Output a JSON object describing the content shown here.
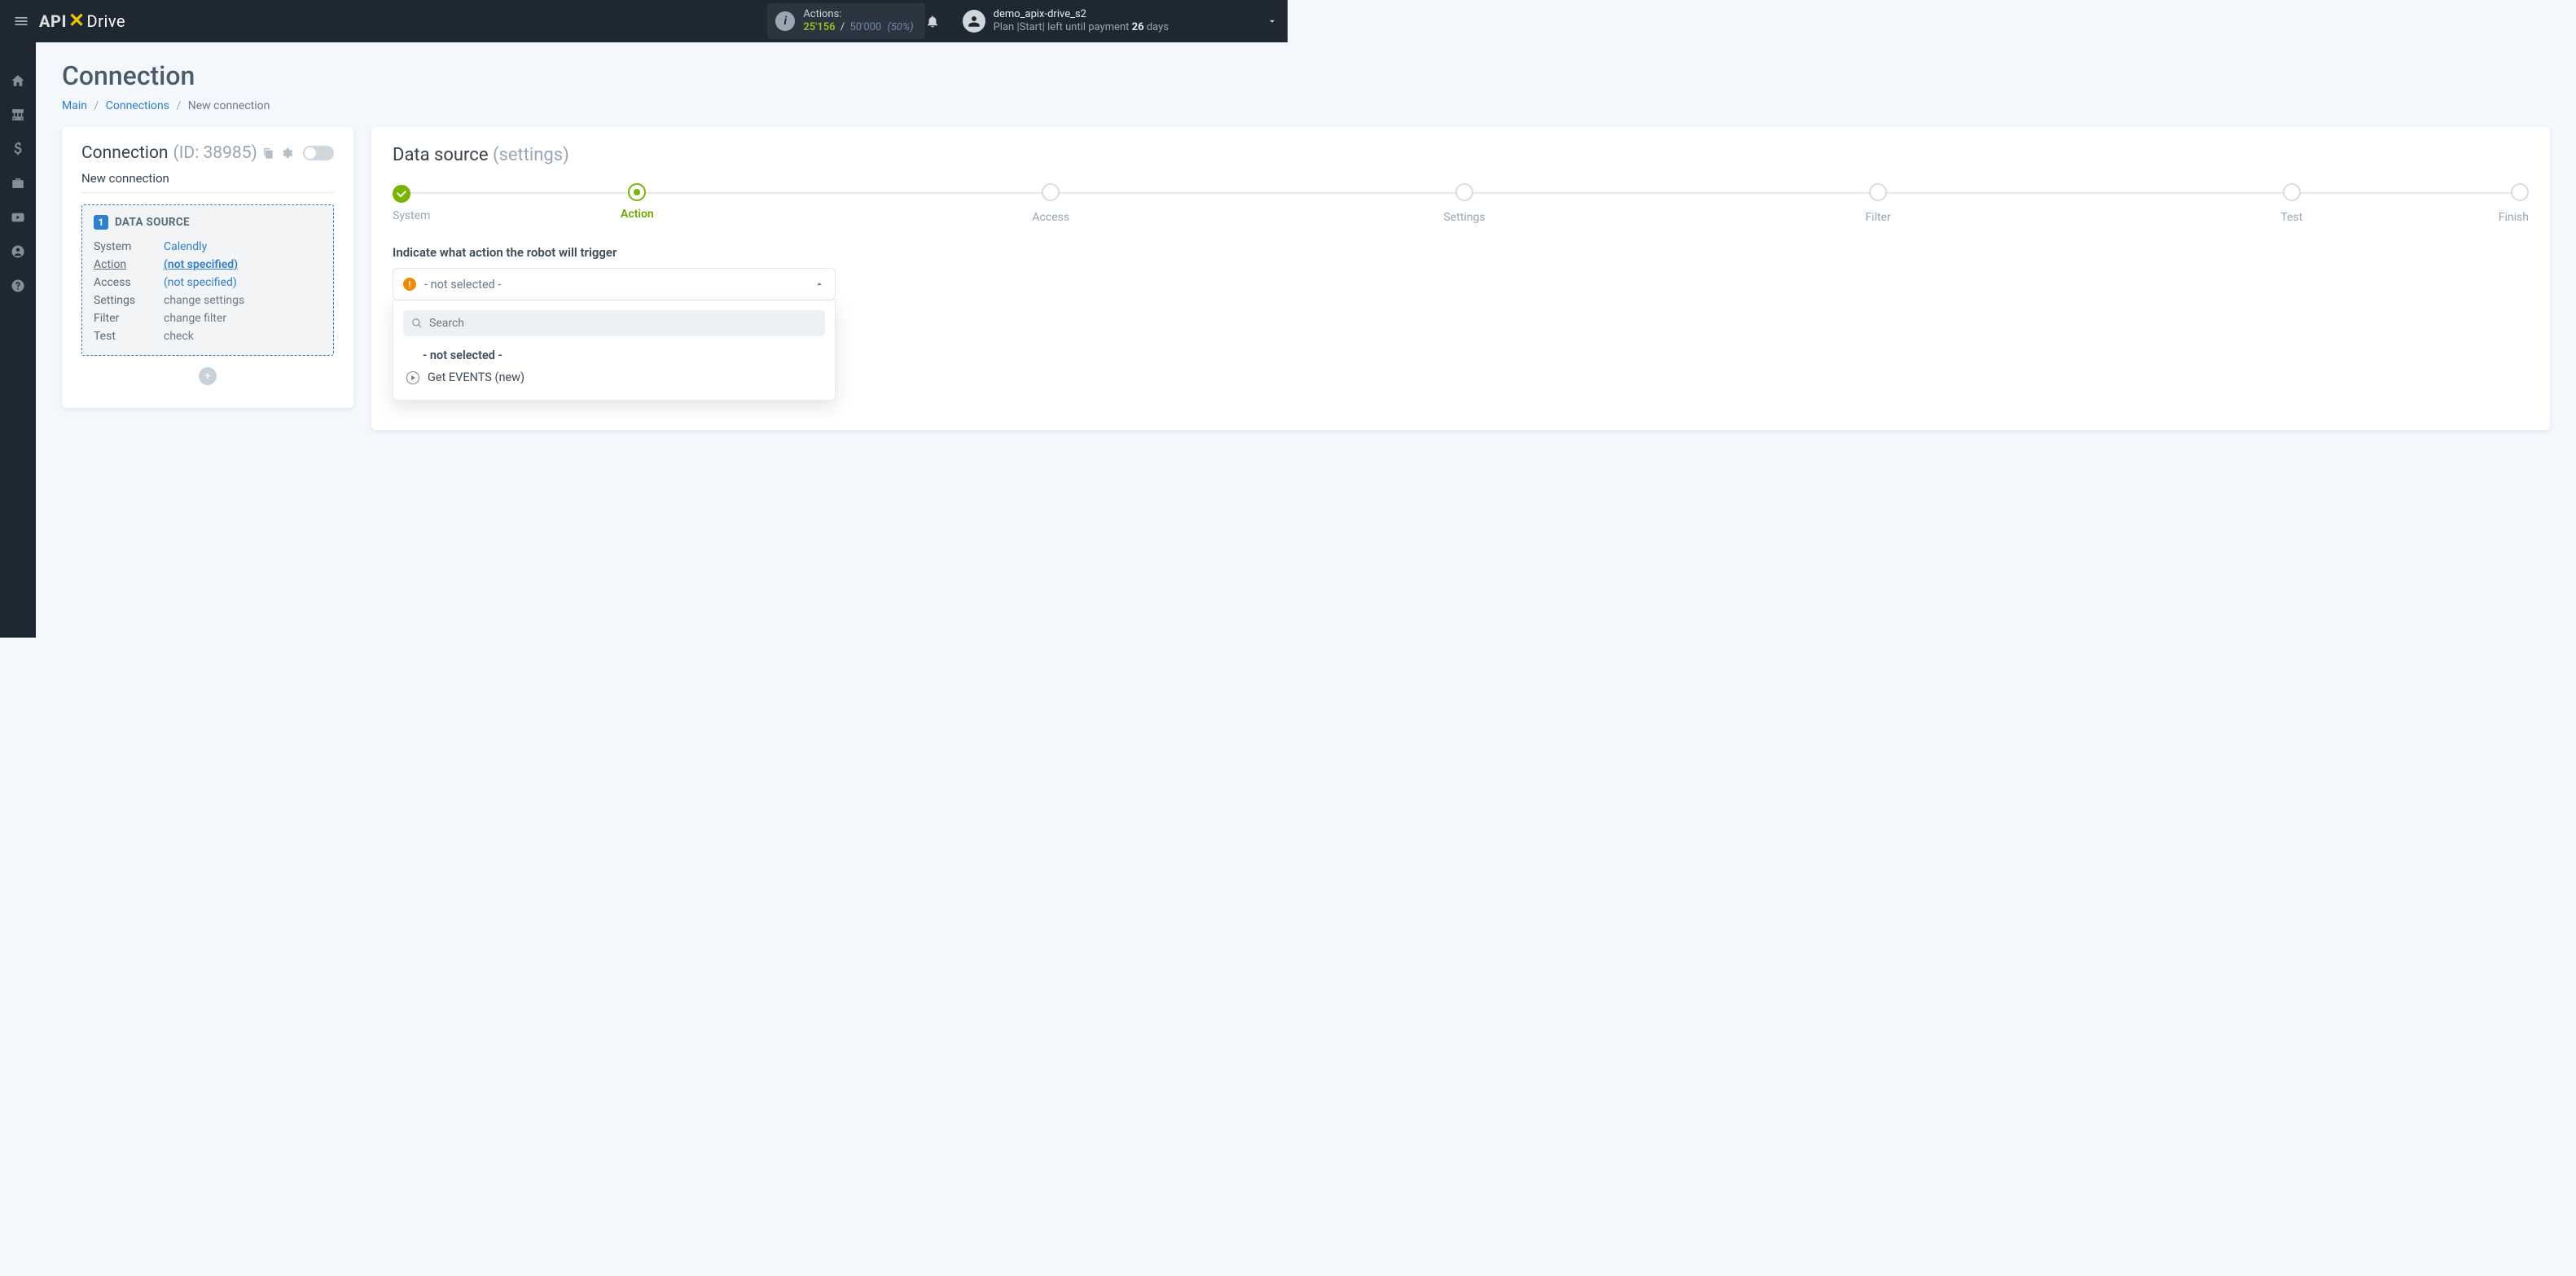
{
  "header": {
    "logo_api": "API",
    "logo_drive": "Drive",
    "actions_label": "Actions:",
    "actions_used": "25'156",
    "actions_limit": "50'000",
    "actions_pct": "(50%)",
    "user_name": "demo_apix-drive_s2",
    "plan_prefix": "Plan",
    "plan_name": "|Start|",
    "plan_rest": "left until payment",
    "plan_days": "26",
    "plan_days_suffix": "days"
  },
  "page": {
    "title": "Connection",
    "crumb_main": "Main",
    "crumb_conns": "Connections",
    "crumb_new": "New connection"
  },
  "left": {
    "title": "Connection",
    "id": "(ID: 38985)",
    "name": "New connection",
    "ds_title": "DATA SOURCE",
    "rows": {
      "system_k": "System",
      "system_v": "Calendly",
      "action_k": "Action",
      "action_v": "(not specified)",
      "access_k": "Access",
      "access_v": "(not specified)",
      "settings_k": "Settings",
      "settings_v": "change settings",
      "filter_k": "Filter",
      "filter_v": "change filter",
      "test_k": "Test",
      "test_v": "check"
    }
  },
  "right": {
    "title": "Data source",
    "subtitle": "(settings)",
    "steps": {
      "s1": "System",
      "s2": "Action",
      "s3": "Access",
      "s4": "Settings",
      "s5": "Filter",
      "s6": "Test",
      "s7": "Finish"
    },
    "select_label": "Indicate what action the robot will trigger",
    "select_value": "- not selected -",
    "search_ph": "Search",
    "opt_ns": "- not selected -",
    "opt_events": "Get EVENTS (new)"
  }
}
